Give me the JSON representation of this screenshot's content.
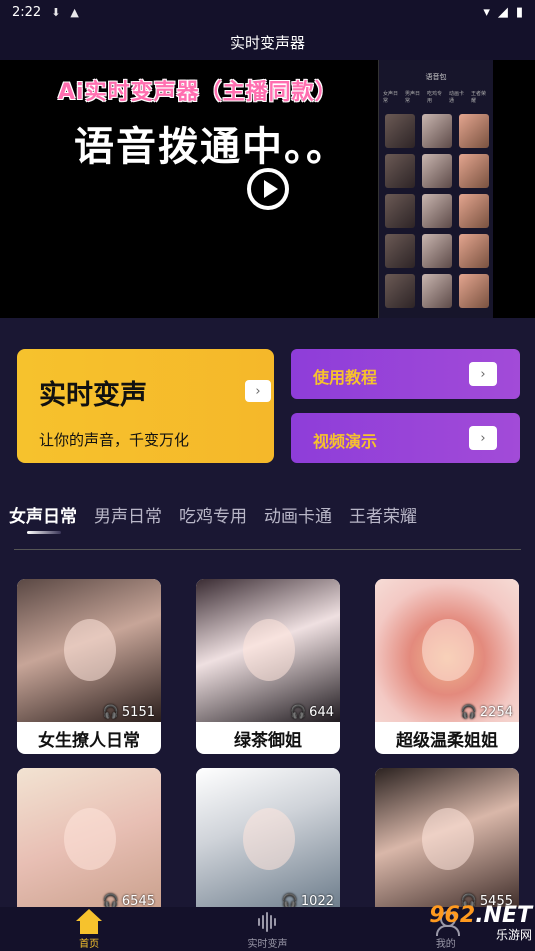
{
  "status_bar": {
    "time": "2:22"
  },
  "header": {
    "title": "实时变声器"
  },
  "video": {
    "title_line": "Ai实时变声器（主播同款）",
    "subtitle_line": "语音拨通中。。",
    "preview_title": "语音包",
    "preview_tabs": [
      "女声日常",
      "男声日常",
      "吃鸡专用",
      "动画卡通",
      "王者荣耀"
    ]
  },
  "feature_cards": {
    "main": {
      "title": "实时变声",
      "desc": "让你的声音，千变万化"
    },
    "tutorial": {
      "title": "使用教程"
    },
    "demo": {
      "title": "视频演示"
    },
    "arrow_glyph": "›"
  },
  "tabs": [
    {
      "label": "女声日常",
      "active": true
    },
    {
      "label": "男声日常",
      "active": false
    },
    {
      "label": "吃鸡专用",
      "active": false
    },
    {
      "label": "动画卡通",
      "active": false
    },
    {
      "label": "王者荣耀",
      "active": false
    }
  ],
  "voices": [
    {
      "name": "女生撩人日常",
      "plays": "5151"
    },
    {
      "name": "绿茶御姐",
      "plays": "644"
    },
    {
      "name": "超级温柔姐姐",
      "plays": "2254"
    },
    {
      "name": "",
      "plays": "6545"
    },
    {
      "name": "",
      "plays": "1022"
    },
    {
      "name": "",
      "plays": "5455"
    }
  ],
  "bottom_nav": [
    {
      "label": "首页",
      "icon": "home-icon",
      "active": true
    },
    {
      "label": "实时变声",
      "icon": "wave-icon",
      "active": false
    },
    {
      "label": "我的",
      "icon": "user-icon",
      "active": false
    }
  ],
  "watermark": {
    "top_a": "962",
    "top_b": ".NET",
    "bottom": "乐游网"
  },
  "colors": {
    "accent_yellow": "#f6c22d",
    "accent_purple": "#9b45d9",
    "background": "#1a1733"
  }
}
